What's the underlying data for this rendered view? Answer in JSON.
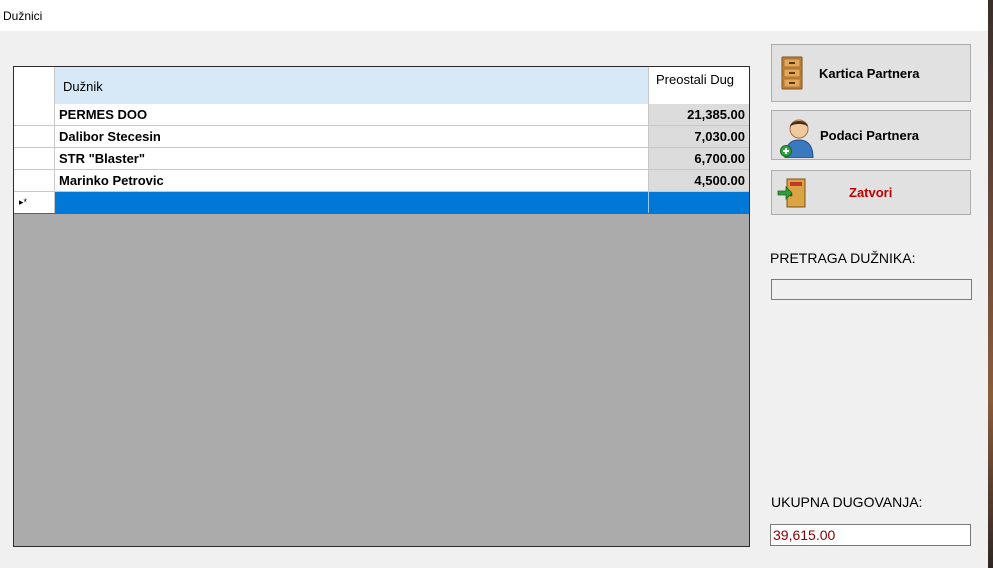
{
  "window": {
    "title": "Dužnici"
  },
  "grid": {
    "columns": [
      "Dužnik",
      "Preostali Dug"
    ],
    "rows": [
      {
        "name": "PERMES DOO",
        "dug": "21,385.00"
      },
      {
        "name": "Dalibor Stecesin",
        "dug": "7,030.00"
      },
      {
        "name": "STR \"Blaster\"",
        "dug": "6,700.00"
      },
      {
        "name": "Marinko Petrovic",
        "dug": "4,500.00"
      }
    ],
    "new_row_marker": "▸*"
  },
  "buttons": {
    "kartica": "Kartica Partnera",
    "podaci": "Podaci Partnera",
    "zatvori": "Zatvori"
  },
  "icons": {
    "kartica": "file-cabinet-icon",
    "podaci": "user-add-icon",
    "zatvori": "exit-door-icon"
  },
  "search": {
    "label": "PRETRAGA DUŽNIKA:",
    "value": ""
  },
  "total": {
    "label": "UKUPNA DUGOVANJA:",
    "value": "39,615.00"
  },
  "colors": {
    "selection": "#0078d7",
    "total_text": "#8b0000",
    "close_text": "#c00000"
  }
}
